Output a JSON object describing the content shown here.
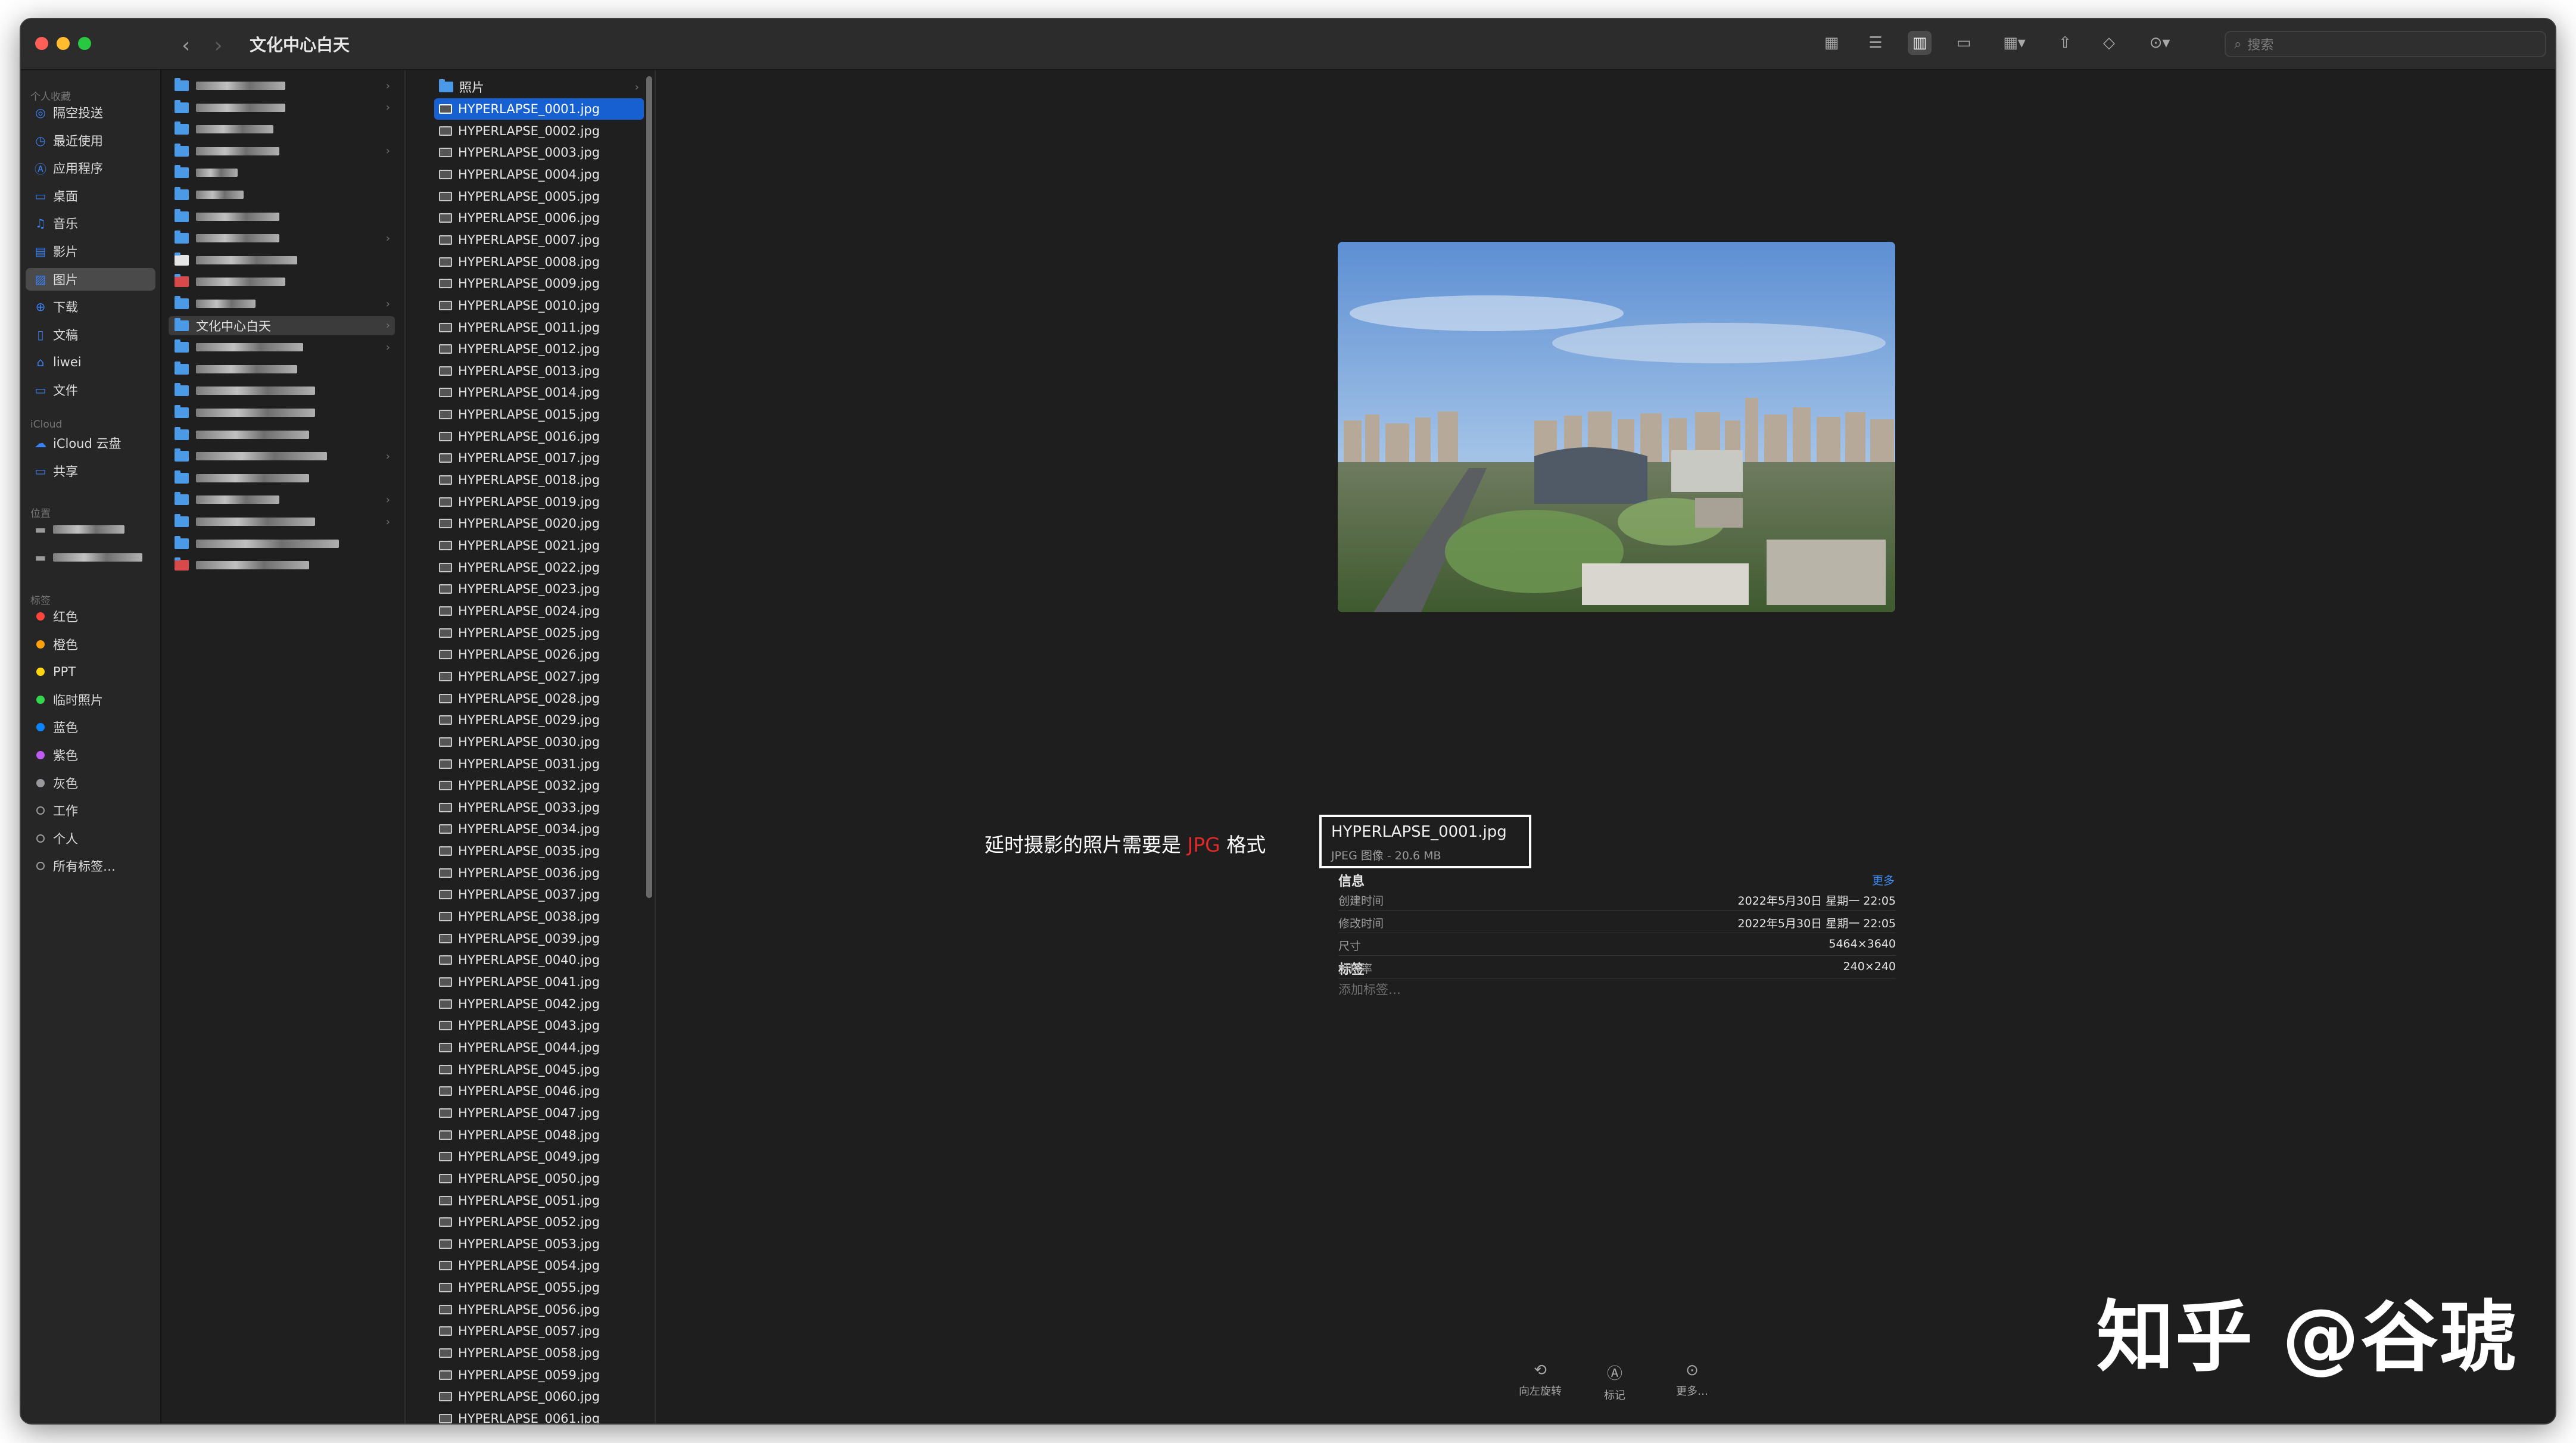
{
  "window": {
    "title": "文化中心白天",
    "nav_back": "‹",
    "nav_forward": "›"
  },
  "toolbar": {
    "search_placeholder": "搜索",
    "tools": [
      "icon-view",
      "list-view",
      "column-view",
      "gallery-view",
      "group-by",
      "share",
      "tag",
      "more-actions"
    ]
  },
  "sidebar": {
    "favorites_header": "个人收藏",
    "favorites": [
      {
        "label": "隔空投送",
        "icon": "airdrop-icon",
        "glyph": "◎"
      },
      {
        "label": "最近使用",
        "icon": "clock-icon",
        "glyph": "◷"
      },
      {
        "label": "应用程序",
        "icon": "apps-icon",
        "glyph": "Ⓐ"
      },
      {
        "label": "桌面",
        "icon": "desktop-icon",
        "glyph": "▭"
      },
      {
        "label": "音乐",
        "icon": "music-icon",
        "glyph": "♫"
      },
      {
        "label": "影片",
        "icon": "film-icon",
        "glyph": "▤"
      },
      {
        "label": "图片",
        "icon": "photos-icon",
        "glyph": "▨"
      },
      {
        "label": "下载",
        "icon": "download-icon",
        "glyph": "⊕"
      },
      {
        "label": "文稿",
        "icon": "document-icon",
        "glyph": "▯"
      },
      {
        "label": "liwei",
        "icon": "home-icon",
        "glyph": "⌂"
      },
      {
        "label": "文件",
        "icon": "folder-icon",
        "glyph": "▭"
      }
    ],
    "icloud_header": "iCloud",
    "icloud": [
      {
        "label": "iCloud 云盘",
        "icon": "cloud-icon",
        "glyph": "☁"
      },
      {
        "label": "共享",
        "icon": "shared-folder-icon",
        "glyph": "▭"
      }
    ],
    "locations_header": "位置",
    "tags_header": "标签",
    "tags": [
      {
        "label": "红色",
        "color": "#ff453a"
      },
      {
        "label": "橙色",
        "color": "#ff9f0a"
      },
      {
        "label": "PPT",
        "color": "#ffd60a"
      },
      {
        "label": "临时照片",
        "color": "#32d74b"
      },
      {
        "label": "蓝色",
        "color": "#0a84ff"
      },
      {
        "label": "紫色",
        "color": "#bf5af2"
      },
      {
        "label": "灰色",
        "color": "#98989d"
      },
      {
        "label": "工作",
        "color": ""
      },
      {
        "label": "个人",
        "color": ""
      },
      {
        "label": "所有标签…",
        "color": ""
      }
    ]
  },
  "column1": {
    "selected_folder": "文化中心白天"
  },
  "column2": {
    "folder_row": "照片",
    "files": [
      "HYPERLAPSE_0001.jpg",
      "HYPERLAPSE_0002.jpg",
      "HYPERLAPSE_0003.jpg",
      "HYPERLAPSE_0004.jpg",
      "HYPERLAPSE_0005.jpg",
      "HYPERLAPSE_0006.jpg",
      "HYPERLAPSE_0007.jpg",
      "HYPERLAPSE_0008.jpg",
      "HYPERLAPSE_0009.jpg",
      "HYPERLAPSE_0010.jpg",
      "HYPERLAPSE_0011.jpg",
      "HYPERLAPSE_0012.jpg",
      "HYPERLAPSE_0013.jpg",
      "HYPERLAPSE_0014.jpg",
      "HYPERLAPSE_0015.jpg",
      "HYPERLAPSE_0016.jpg",
      "HYPERLAPSE_0017.jpg",
      "HYPERLAPSE_0018.jpg",
      "HYPERLAPSE_0019.jpg",
      "HYPERLAPSE_0020.jpg",
      "HYPERLAPSE_0021.jpg",
      "HYPERLAPSE_0022.jpg",
      "HYPERLAPSE_0023.jpg",
      "HYPERLAPSE_0024.jpg",
      "HYPERLAPSE_0025.jpg",
      "HYPERLAPSE_0026.jpg",
      "HYPERLAPSE_0027.jpg",
      "HYPERLAPSE_0028.jpg",
      "HYPERLAPSE_0029.jpg",
      "HYPERLAPSE_0030.jpg",
      "HYPERLAPSE_0031.jpg",
      "HYPERLAPSE_0032.jpg",
      "HYPERLAPSE_0033.jpg",
      "HYPERLAPSE_0034.jpg",
      "HYPERLAPSE_0035.jpg",
      "HYPERLAPSE_0036.jpg",
      "HYPERLAPSE_0037.jpg",
      "HYPERLAPSE_0038.jpg",
      "HYPERLAPSE_0039.jpg",
      "HYPERLAPSE_0040.jpg",
      "HYPERLAPSE_0041.jpg",
      "HYPERLAPSE_0042.jpg",
      "HYPERLAPSE_0043.jpg",
      "HYPERLAPSE_0044.jpg",
      "HYPERLAPSE_0045.jpg",
      "HYPERLAPSE_0046.jpg",
      "HYPERLAPSE_0047.jpg",
      "HYPERLAPSE_0048.jpg",
      "HYPERLAPSE_0049.jpg",
      "HYPERLAPSE_0050.jpg",
      "HYPERLAPSE_0051.jpg",
      "HYPERLAPSE_0052.jpg",
      "HYPERLAPSE_0053.jpg",
      "HYPERLAPSE_0054.jpg",
      "HYPERLAPSE_0055.jpg",
      "HYPERLAPSE_0056.jpg",
      "HYPERLAPSE_0057.jpg",
      "HYPERLAPSE_0058.jpg",
      "HYPERLAPSE_0059.jpg",
      "HYPERLAPSE_0060.jpg",
      "HYPERLAPSE_0061.jpg"
    ],
    "selected_index": 0
  },
  "preview": {
    "annotation_prefix": "延时摄影的照片需要是",
    "annotation_highlight": "JPG",
    "annotation_suffix": "格式",
    "file_name": "HYPERLAPSE_0001.jpg",
    "file_subtitle": "JPEG 图像 - 20.6 MB",
    "info_header": "信息",
    "more_link": "更多",
    "info": [
      {
        "key": "创建时间",
        "value": "2022年5月30日 星期一 22:05"
      },
      {
        "key": "修改时间",
        "value": "2022年5月30日 星期一 22:05"
      },
      {
        "key": "尺寸",
        "value": "5464×3640"
      },
      {
        "key": "分辨率",
        "value": "240×240"
      }
    ],
    "tags_header": "标签",
    "tags_placeholder": "添加标签…",
    "actions": [
      {
        "label": "向左旋转",
        "icon": "rotate-left-icon",
        "glyph": "⟲"
      },
      {
        "label": "标记",
        "icon": "markup-icon",
        "glyph": "Ⓐ"
      },
      {
        "label": "更多…",
        "icon": "more-icon",
        "glyph": "⊙"
      }
    ]
  },
  "watermark": "知乎 @谷琥"
}
